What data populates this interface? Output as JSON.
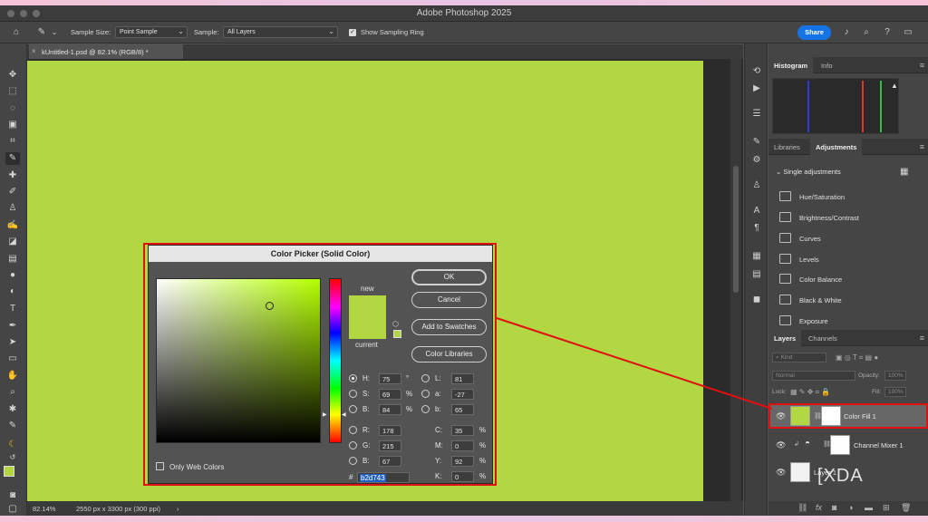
{
  "window": {
    "title": "Adobe Photoshop 2025"
  },
  "options_bar": {
    "sample_size_label": "Sample Size:",
    "sample_size_value": "Point Sample",
    "sample_label": "Sample:",
    "sample_value": "All Layers",
    "show_ring_label": "Show Sampling Ring",
    "share_label": "Share"
  },
  "document": {
    "tab_title": "kUntitled-1.psd @ 82.1% (RGB/8) *"
  },
  "status_bar": {
    "zoom": "82.14%",
    "info": "2550 px x 3300 px (300 ppi)"
  },
  "panels": {
    "histogram_tab": "Histogram",
    "info_tab": "Info",
    "libraries_tab": "Libraries",
    "adjustments_tab": "Adjustments",
    "adjustments_header": "Single adjustments",
    "adjustments": [
      {
        "label": "Hue/Saturation"
      },
      {
        "label": "Brightness/Contrast"
      },
      {
        "label": "Curves"
      },
      {
        "label": "Levels"
      },
      {
        "label": "Color Balance"
      },
      {
        "label": "Black & White"
      },
      {
        "label": "Exposure"
      }
    ],
    "layers_tab": "Layers",
    "channels_tab": "Channels",
    "kind_placeholder": "Kind",
    "blend_mode": "Normal",
    "opacity_label": "Opacity:",
    "opacity_value": "100%",
    "lock_label": "Lock:",
    "fill_label": "Fill:",
    "fill_value": "100%",
    "layers": [
      {
        "name": "Color Fill 1"
      },
      {
        "name": "Channel Mixer 1"
      },
      {
        "name": "Layer 1"
      }
    ]
  },
  "color_picker": {
    "title": "Color Picker (Solid Color)",
    "new_label": "new",
    "current_label": "current",
    "ok": "OK",
    "cancel": "Cancel",
    "add_to_swatches": "Add to Swatches",
    "color_libraries": "Color Libraries",
    "only_web_colors": "Only Web Colors",
    "hex_label": "#",
    "hex": "b2d743",
    "hsb": {
      "h_label": "H:",
      "h": "75",
      "h_unit": "°",
      "s_label": "S:",
      "s": "69",
      "s_unit": "%",
      "b_label": "B:",
      "b": "84",
      "b_unit": "%"
    },
    "rgb": {
      "r_label": "R:",
      "r": "178",
      "g_label": "G:",
      "g": "215",
      "b_label": "B:",
      "b": "67"
    },
    "lab": {
      "l_label": "L:",
      "l": "81",
      "a_label": "a:",
      "a": "-27",
      "b_label": "b:",
      "b": "65"
    },
    "cmyk": {
      "c_label": "C:",
      "c": "35",
      "m_label": "M:",
      "m": "0",
      "y_label": "Y:",
      "y": "92",
      "k_label": "K:",
      "k": "0",
      "unit": "%"
    }
  },
  "watermark": "XDA",
  "colors": {
    "fill": "#b2d743",
    "accent": "#1473e6",
    "highlight_outline": "#e01010"
  }
}
